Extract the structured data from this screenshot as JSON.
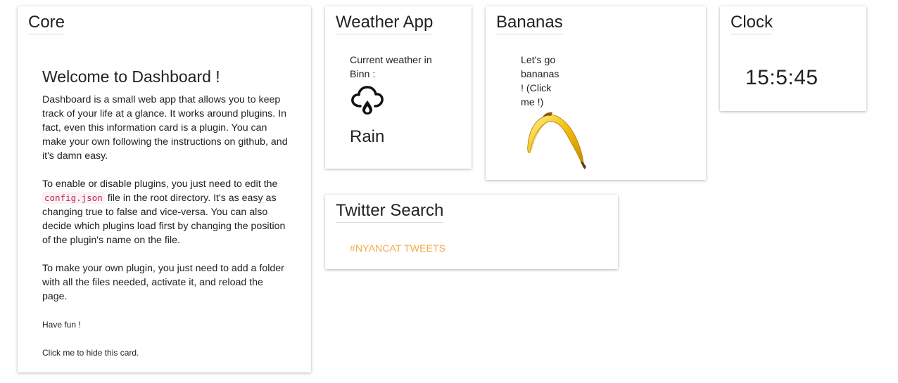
{
  "core": {
    "title": "Core",
    "heading": "Welcome to Dashboard !",
    "paragraph1": "Dashboard is a small web app that allows you to keep track of your life at a glance. It works around plugins. In fact, even this information card is a plugin. You can make your own following the instructions on github, and it's damn easy.",
    "paragraph2_before": "To enable or disable plugins, you just need to edit the",
    "paragraph2_code": "config.json",
    "paragraph2_after": "file in the root directory. It's as easy as changing true to false and vice-versa. You can also decide which plugins load first by changing the position of the plugin's name on the file.",
    "paragraph3": "To make your own plugin, you just need to add a folder with all the files needed, activate it, and reload the page.",
    "have_fun": "Have fun !",
    "hide_hint": "Click me to hide this card."
  },
  "weather": {
    "title": "Weather App",
    "label": "Current weather in Binn :",
    "icon": "cloud-rain-icon",
    "condition": "Rain"
  },
  "bananas": {
    "title": "Bananas",
    "text": "Let's go bananas ! (Click me !)",
    "image": "banana-image"
  },
  "clock": {
    "title": "Clock",
    "time": "15:5:45"
  },
  "twitter": {
    "title": "Twitter Search",
    "link": "#NYANCAT TWEETS",
    "link_color": "#f0ad4e"
  }
}
